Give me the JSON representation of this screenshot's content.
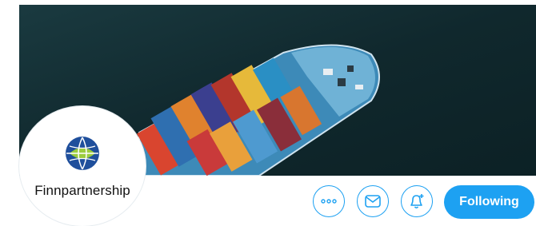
{
  "avatar": {
    "org_name": "Finnpartnership"
  },
  "actions": {
    "more_icon": "more-dots-icon",
    "message_icon": "envelope-icon",
    "notify_icon": "bell-plus-icon",
    "follow_label": "Following"
  },
  "colors": {
    "accent": "#1da1f2",
    "banner_sea": "#0f2a30"
  }
}
